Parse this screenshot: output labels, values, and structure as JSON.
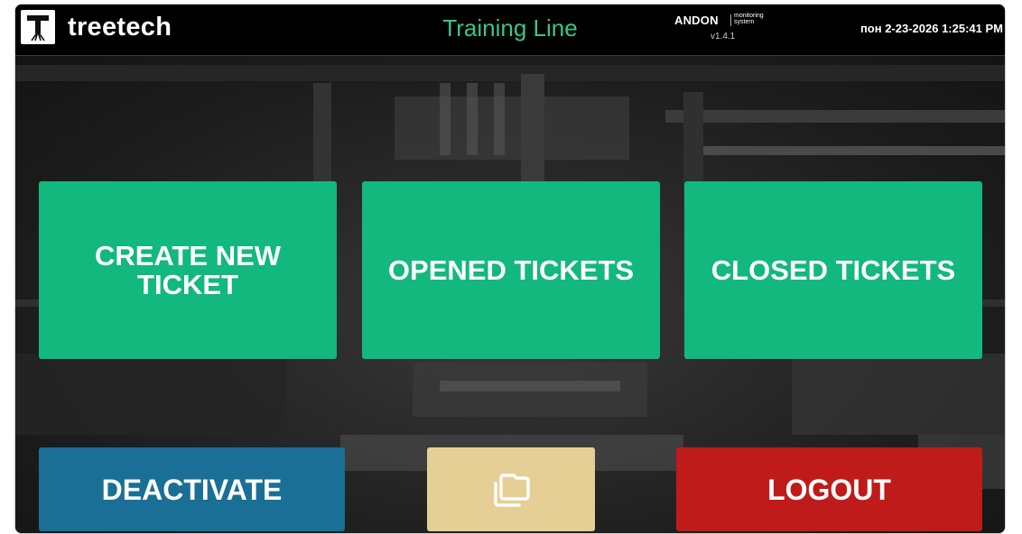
{
  "header": {
    "logo_letter": "T",
    "brand": "treetech",
    "line_title": "Training Line",
    "andon": {
      "word": "ANDON",
      "subtitle_line1": "monitoring",
      "subtitle_line2": "system",
      "version": "v1.4.1"
    },
    "clock": "пон 2-23-2026 1:25:41 PM"
  },
  "tiles": {
    "create_ticket": "CREATE NEW TICKET",
    "opened_tickets": "OPENED TICKETS",
    "closed_tickets": "CLOSED TICKETS"
  },
  "actions": {
    "deactivate": "DEACTIVATE",
    "copy_icon": "copy-icon",
    "logout": "LOGOUT"
  },
  "colors": {
    "title_green": "#3cc48a",
    "tile_green": "#12b87d",
    "deactivate_blue": "#1a6f96",
    "copy_beige": "#e6cf95",
    "logout_red": "#bf1b1b"
  }
}
